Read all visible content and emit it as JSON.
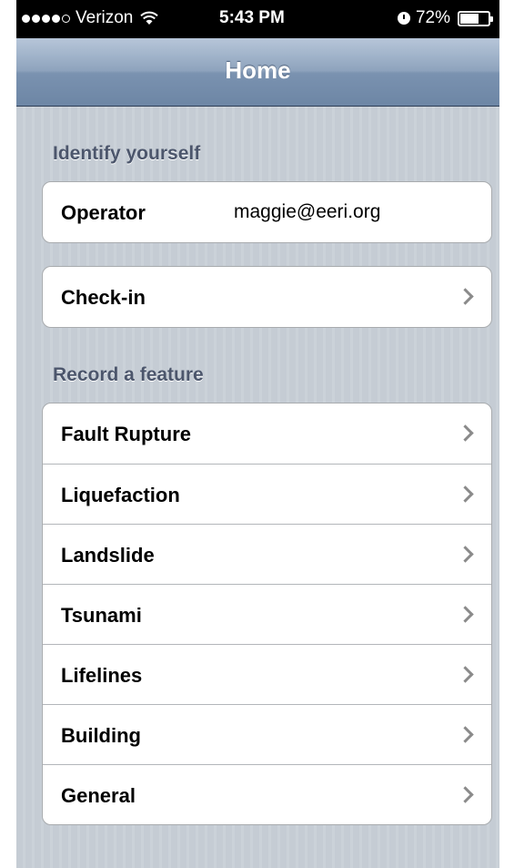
{
  "status_bar": {
    "signal_bars_filled": 4,
    "signal_bars_total": 5,
    "carrier": "Verizon",
    "time": "5:43 PM",
    "battery": "72%",
    "battery_level": 0.72
  },
  "nav": {
    "title": "Home"
  },
  "sections": {
    "identify": {
      "header": "Identify yourself",
      "operator_label": "Operator",
      "operator_value": "maggie@eeri.org",
      "checkin_label": "Check-in"
    },
    "record": {
      "header": "Record a feature",
      "items": [
        "Fault Rupture",
        "Liquefaction",
        "Landslide",
        "Tsunami",
        "Lifelines",
        "Building",
        "General"
      ]
    }
  },
  "colors": {
    "nav_gradient_top": "#b7c6d9",
    "nav_gradient_bottom": "#6d86a5",
    "background": "#c5ccd4",
    "section_header": "#4c566c"
  },
  "icons": {
    "wifi": "wifi-icon",
    "alarm": "alarm-clock-icon",
    "battery": "battery-icon",
    "disclosure": "chevron-right-icon"
  }
}
